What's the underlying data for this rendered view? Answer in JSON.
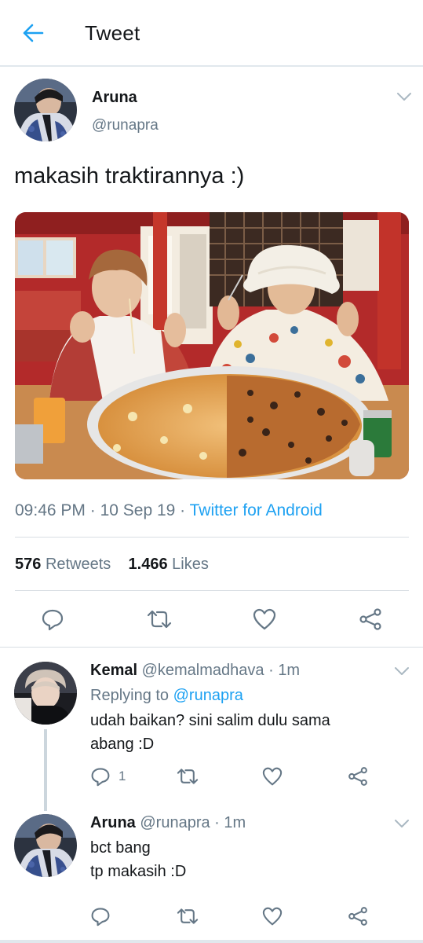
{
  "header": {
    "title": "Tweet"
  },
  "colors": {
    "accent": "#1da1f2",
    "muted": "#657786",
    "text": "#14171a",
    "divider": "#e1e8ed"
  },
  "tweet": {
    "name": "Aruna",
    "handle": "@runapra",
    "text": "makasih traktirannya :)",
    "time": "09:46 PM",
    "date": "10 Sep 19",
    "source": "Twitter for Android",
    "retweets": "576",
    "retweets_label": "Retweets",
    "likes": "1.466",
    "likes_label": "Likes",
    "icons": [
      "reply-icon",
      "retweet-icon",
      "like-icon",
      "share-icon"
    ]
  },
  "replies": [
    {
      "name": "Kemal",
      "handle": "@kemalmadhava",
      "age": "1m",
      "replying_prefix": "Replying to",
      "replying_to": "@runapra",
      "lines": [
        "udah baikan? sini salim dulu sama",
        "abang :D"
      ],
      "reply_count": "1"
    },
    {
      "name": "Aruna",
      "handle": "@runapra",
      "age": "1m",
      "lines": [
        "bct bang",
        "tp makasih :D"
      ]
    }
  ]
}
